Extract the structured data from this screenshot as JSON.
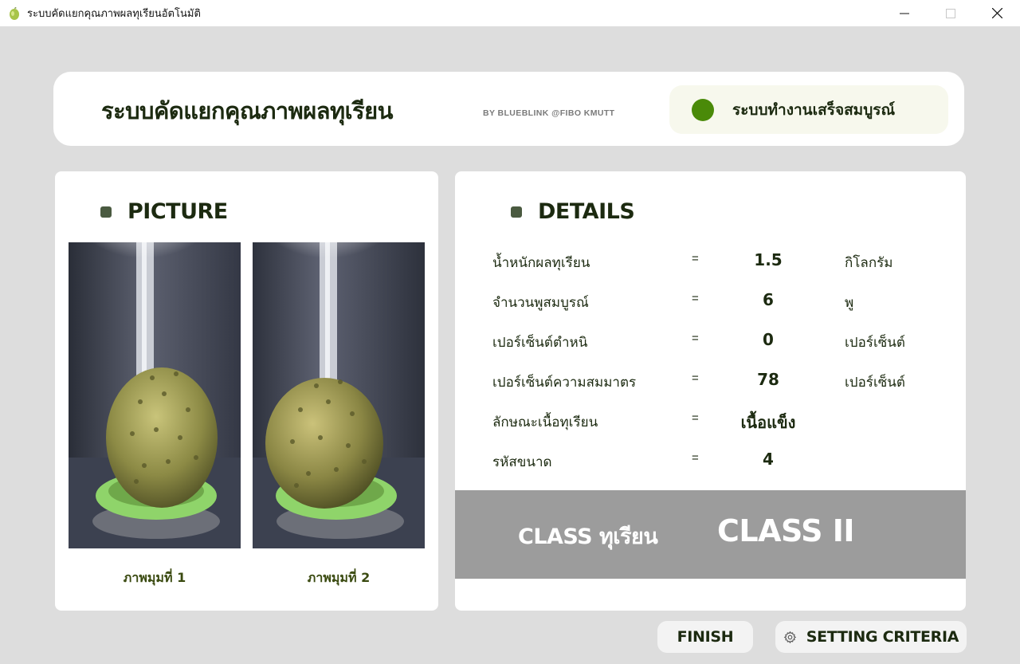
{
  "window": {
    "title": "ระบบคัดแยกคุณภาพผลทุเรียนอัตโนมัติ",
    "controls": [
      "minimize-icon",
      "maximize-icon",
      "close-icon"
    ]
  },
  "header": {
    "title": "ระบบคัดแยกคุณภาพผลทุเรียน",
    "byline": "BY BLUEBLINK @FIBO KMUTT",
    "status_text": "ระบบทำงานเสร็จสมบูรณ์",
    "status_color": "#4a8a09"
  },
  "picture": {
    "heading": "PICTURE",
    "captions": [
      "ภาพมุมที่ 1",
      "ภาพมุมที่ 2"
    ]
  },
  "details": {
    "heading": "DETAILS",
    "rows": [
      {
        "label": "น้ำหนักผลทุเรียน",
        "eq": "=",
        "value": "1.5",
        "unit": "กิโลกรัม"
      },
      {
        "label": "จำนวนพูสมบูรณ์",
        "eq": "=",
        "value": "6",
        "unit": "พู"
      },
      {
        "label": "เปอร์เซ็นต์ตำหนิ",
        "eq": "=",
        "value": "0",
        "unit": "เปอร์เซ็นต์"
      },
      {
        "label": "เปอร์เซ็นต์ความสมมาตร",
        "eq": "=",
        "value": "78",
        "unit": "เปอร์เซ็นต์"
      },
      {
        "label": "ลักษณะเนื้อทุเรียน",
        "eq": "=",
        "value": "เนื้อแข็ง",
        "unit": ""
      },
      {
        "label": "รหัสขนาด",
        "eq": "=",
        "value": "4",
        "unit": ""
      }
    ],
    "class_label": "CLASS ทุเรียน",
    "class_value": "CLASS II"
  },
  "buttons": {
    "finish": "FINISH",
    "settings": "SETTING CRITERIA"
  },
  "colors": {
    "background": "#dddddd",
    "text_dark": "#1c2a10",
    "class_bar": "#9c9c9c",
    "fruit_holder": "#8fd46a"
  }
}
